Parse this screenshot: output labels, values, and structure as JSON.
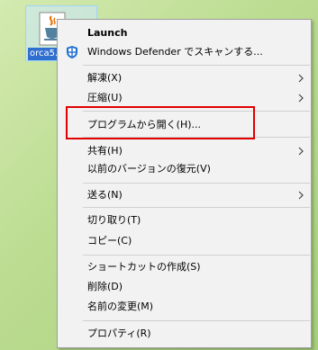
{
  "desktop": {
    "icon_label": "orca5.",
    "icon_name": "java-file-icon"
  },
  "context_menu": {
    "launch": "Launch",
    "defender": "Windows Defender でスキャンする...",
    "extract": "解凍(X)",
    "compress": "圧縮(U)",
    "open_with": "プログラムから開く(H)...",
    "share": "共有(H)",
    "restore_prev": "以前のバージョンの復元(V)",
    "send_to": "送る(N)",
    "cut": "切り取り(T)",
    "copy": "コピー(C)",
    "create_shortcut": "ショートカットの作成(S)",
    "delete": "削除(D)",
    "rename": "名前の変更(M)",
    "properties": "プロパティ(R)"
  },
  "colors": {
    "highlight": "#e00000",
    "menu_bg": "#f2f2f2",
    "desktop_bg": "#b6d98c"
  }
}
